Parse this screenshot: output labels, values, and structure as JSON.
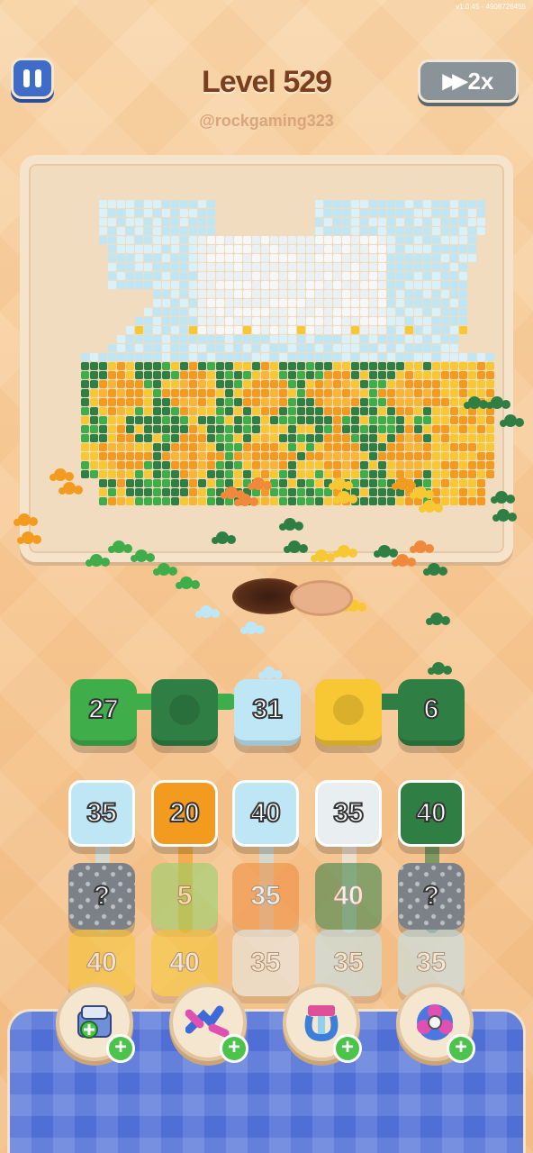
{
  "version_text": "v1.0.45 - 4908726455",
  "header": {
    "title": "Level 529",
    "watermark": "@rockgaming323",
    "speed_label": "2x",
    "pause_icon": "pause-icon",
    "speed_icon": "fast-forward-icon"
  },
  "colors": {
    "accent_blue": "#3f6bc9",
    "dark_green": "#2f7f45",
    "green": "#3fae4a",
    "light_green": "#8fd36b",
    "light_blue": "#bfe6f5",
    "white_tile": "#e9eef1",
    "yellow": "#f7c833",
    "orange": "#f39b1f",
    "deep_orange": "#f08a3a",
    "gray": "#7b8187"
  },
  "active_slots": [
    {
      "value": "27",
      "color": "green"
    },
    {
      "value": "",
      "color": "dark_green"
    },
    {
      "value": "31",
      "color": "light_blue"
    },
    {
      "value": "",
      "color": "yellow"
    },
    {
      "value": "6",
      "color": "dark_green"
    }
  ],
  "queue": [
    [
      {
        "value": "35",
        "color": "light_blue",
        "faded": false
      },
      {
        "value": "?",
        "color": "gray",
        "faded": false,
        "mystery": true
      },
      {
        "value": "40",
        "color": "yellow",
        "faded": true
      }
    ],
    [
      {
        "value": "20",
        "color": "orange",
        "faded": false
      },
      {
        "value": "5",
        "color": "light_green",
        "faded": true
      },
      {
        "value": "40",
        "color": "yellow",
        "faded": true
      }
    ],
    [
      {
        "value": "40",
        "color": "light_blue",
        "faded": false
      },
      {
        "value": "35",
        "color": "deep_orange",
        "faded": true
      },
      {
        "value": "35",
        "color": "white_tile",
        "faded": true
      }
    ],
    [
      {
        "value": "35",
        "color": "white_tile",
        "faded": false
      },
      {
        "value": "40",
        "color": "dark_green",
        "faded": true
      },
      {
        "value": "35",
        "color": "light_blue",
        "faded": true
      }
    ],
    [
      {
        "value": "40",
        "color": "dark_green",
        "faded": false
      },
      {
        "value": "?",
        "color": "gray",
        "faded": false,
        "mystery": true
      },
      {
        "value": "35",
        "color": "light_blue",
        "faded": true
      }
    ]
  ],
  "boosters": [
    {
      "name": "add-slot-booster",
      "icon": "add-box-icon"
    },
    {
      "name": "shuffle-booster",
      "icon": "shuffle-arrows-icon"
    },
    {
      "name": "magnet-booster",
      "icon": "magnet-icon"
    },
    {
      "name": "spin-booster",
      "icon": "fan-icon"
    }
  ]
}
